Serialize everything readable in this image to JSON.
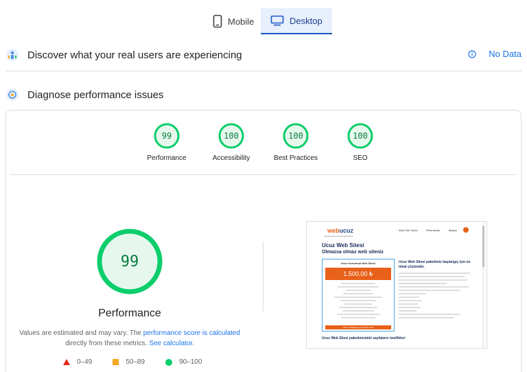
{
  "tabs": {
    "mobile": "Mobile",
    "desktop": "Desktop"
  },
  "sections": {
    "real_users": "Discover what your real users are experiencing",
    "no_data": "No Data",
    "diagnose": "Diagnose performance issues"
  },
  "categories": [
    {
      "label": "Performance",
      "score": "99",
      "fraction": 0.99
    },
    {
      "label": "Accessibility",
      "score": "100",
      "fraction": 1.0
    },
    {
      "label": "Best Practices",
      "score": "100",
      "fraction": 1.0
    },
    {
      "label": "SEO",
      "score": "100",
      "fraction": 1.0
    }
  ],
  "main": {
    "score": "99",
    "fraction": 0.99,
    "title": "Performance",
    "note_prefix": "Values are estimated and may vary. The ",
    "note_link1": "performance score is calculated",
    "note_mid": "directly from these metrics. ",
    "note_link2": "See calculator",
    "note_suffix": "."
  },
  "legend": {
    "fail": "0–49",
    "average": "50–89",
    "pass": "90–100"
  },
  "preview": {
    "logo_a": "web",
    "logo_b": "ucuz",
    "tagline": "ekonomik kurumsal web siteleri",
    "nav": [
      "Web Site Tipleri",
      "Referanslar",
      "İletişim"
    ],
    "heading1": "Ucuz Web Sitesi",
    "heading2": "Olmazsa olmaz web siteniz",
    "box_title": "Ucuz Kurumsal Web Sitesi",
    "price": "1.500,00 ₺",
    "button": "Hemen Whatsapp ile sipariş verin",
    "right_title": "Ucuz Web Sitesi paketimiz başlangıç için en ideal çözümdür.",
    "footer": "Ucuz Web Sitesi paketimizdeki sayfaların özellikleri"
  },
  "colors": {
    "pass": "#0cce6b",
    "pass_text": "#0c7a3f",
    "average": "#f5a623",
    "fail": "#e8271a",
    "accent": "#1a73e8"
  }
}
